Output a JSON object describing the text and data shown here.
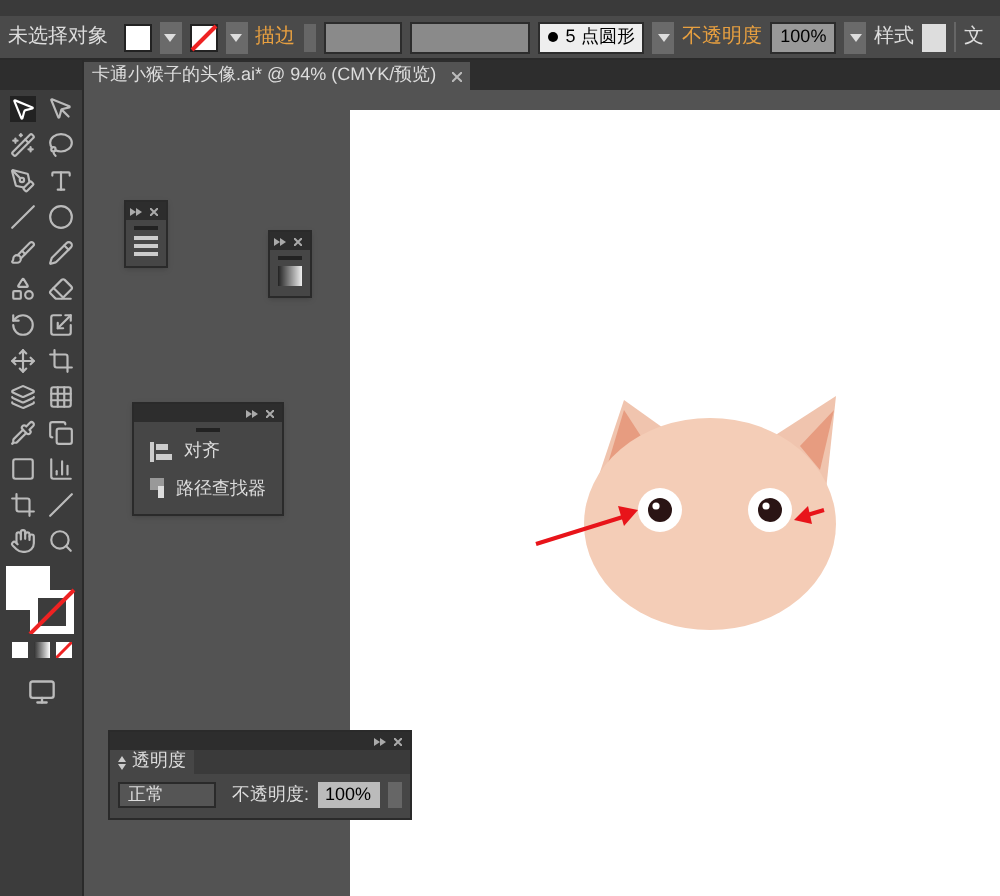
{
  "control_bar": {
    "selection_label": "未选择对象",
    "stroke_label": "描边",
    "brush": "5 点圆形",
    "opacity_label": "不透明度",
    "opacity_value": "100%",
    "style_label": "样式",
    "extra_button": "文"
  },
  "document_tab": {
    "title": "卡通小猴子的头像.ai* @ 94% (CMYK/预览)",
    "selected": true
  },
  "panels": [
    {
      "kind": "icon"
    },
    {
      "kind": "icon"
    },
    {
      "kind": "list",
      "items": [
        {
          "label": "对齐"
        },
        {
          "label": "路径查找器"
        }
      ]
    }
  ],
  "transparency_panel": {
    "title": "透明度",
    "blend_mode": "正常",
    "opacity_label": "不透明度:",
    "opacity_value": "100%"
  }
}
